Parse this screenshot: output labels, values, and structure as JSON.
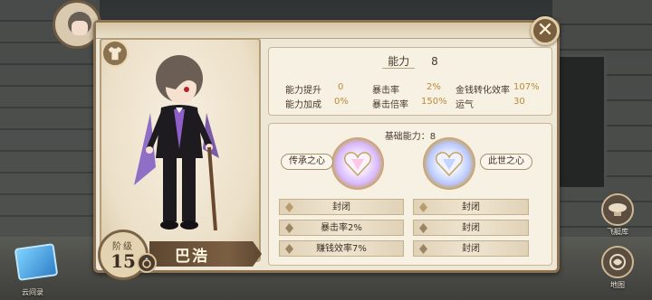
{
  "panel": {
    "close_icon": "close-icon"
  },
  "character": {
    "level_label": "阶级",
    "level": "15",
    "name": "巴浩"
  },
  "stats": {
    "title_label": "能力",
    "title_value": "8",
    "items": [
      {
        "label": "能力提升",
        "value": "0"
      },
      {
        "label": "暴击率",
        "value": "2%"
      },
      {
        "label": "金钱转化效率",
        "value": "107%"
      },
      {
        "label": "能力加成",
        "value": "0%"
      },
      {
        "label": "暴击倍率",
        "value": "150%"
      },
      {
        "label": "运气",
        "value": "30"
      }
    ]
  },
  "base": {
    "title": "基础能力：8",
    "left_heart_label": "传承之心",
    "right_heart_label": "此世之心",
    "left_slots": [
      "封闭",
      "暴击率2%",
      "赚钱效率7%"
    ],
    "right_slots": [
      "封闭",
      "封闭",
      "封闭"
    ]
  },
  "side": {
    "airship_label": "飞艇库",
    "map_label": "地图",
    "cloud_label": "云间录"
  },
  "colors": {
    "panel_bg": "#efe7d6",
    "accent_brown": "#7a5f3f",
    "value_gold": "#b98a3a"
  }
}
